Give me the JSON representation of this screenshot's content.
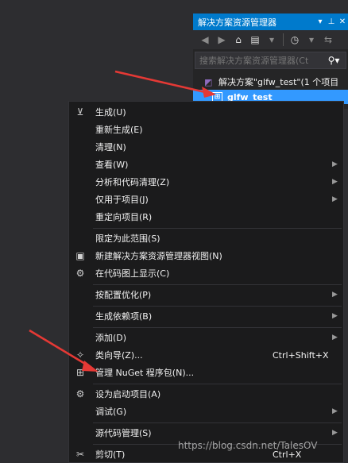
{
  "solution_explorer": {
    "title": "解决方案资源管理器",
    "search_placeholder": "搜索解决方案资源管理器(Ct",
    "solution_label": "解决方案\"glfw_test\"(1 个项目",
    "project_label": "glfw_test"
  },
  "menu": [
    {
      "label": "生成(U)",
      "icon": "build-icon"
    },
    {
      "label": "重新生成(E)"
    },
    {
      "label": "清理(N)"
    },
    {
      "label": "查看(W)",
      "submenu": true
    },
    {
      "label": "分析和代码清理(Z)",
      "submenu": true
    },
    {
      "label": "仅用于项目(J)",
      "submenu": true
    },
    {
      "label": "重定向项目(R)"
    },
    {
      "label": "限定为此范围(S)"
    },
    {
      "label": "新建解决方案资源管理器视图(N)",
      "icon": "new-view-icon"
    },
    {
      "label": "在代码图上显示(C)",
      "icon": "code-map-icon"
    },
    {
      "label": "按配置优化(P)",
      "submenu": true
    },
    {
      "label": "生成依赖项(B)",
      "submenu": true
    },
    {
      "label": "添加(D)",
      "submenu": true
    },
    {
      "label": "类向导(Z)...",
      "icon": "class-wizard-icon",
      "shortcut": "Ctrl+Shift+X"
    },
    {
      "label": "管理 NuGet 程序包(N)...",
      "icon": "nuget-icon"
    },
    {
      "label": "设为启动项目(A)",
      "icon": "gear-icon"
    },
    {
      "label": "调试(G)",
      "submenu": true
    },
    {
      "label": "源代码管理(S)",
      "submenu": true
    },
    {
      "label": "剪切(T)",
      "icon": "scissors-icon",
      "shortcut": "Ctrl+X"
    }
  ],
  "watermark": "https://blog.csdn.net/TalesOV",
  "colors": {
    "accent": "#007acc",
    "selection": "#3399ff",
    "arrow": "#e53935"
  }
}
